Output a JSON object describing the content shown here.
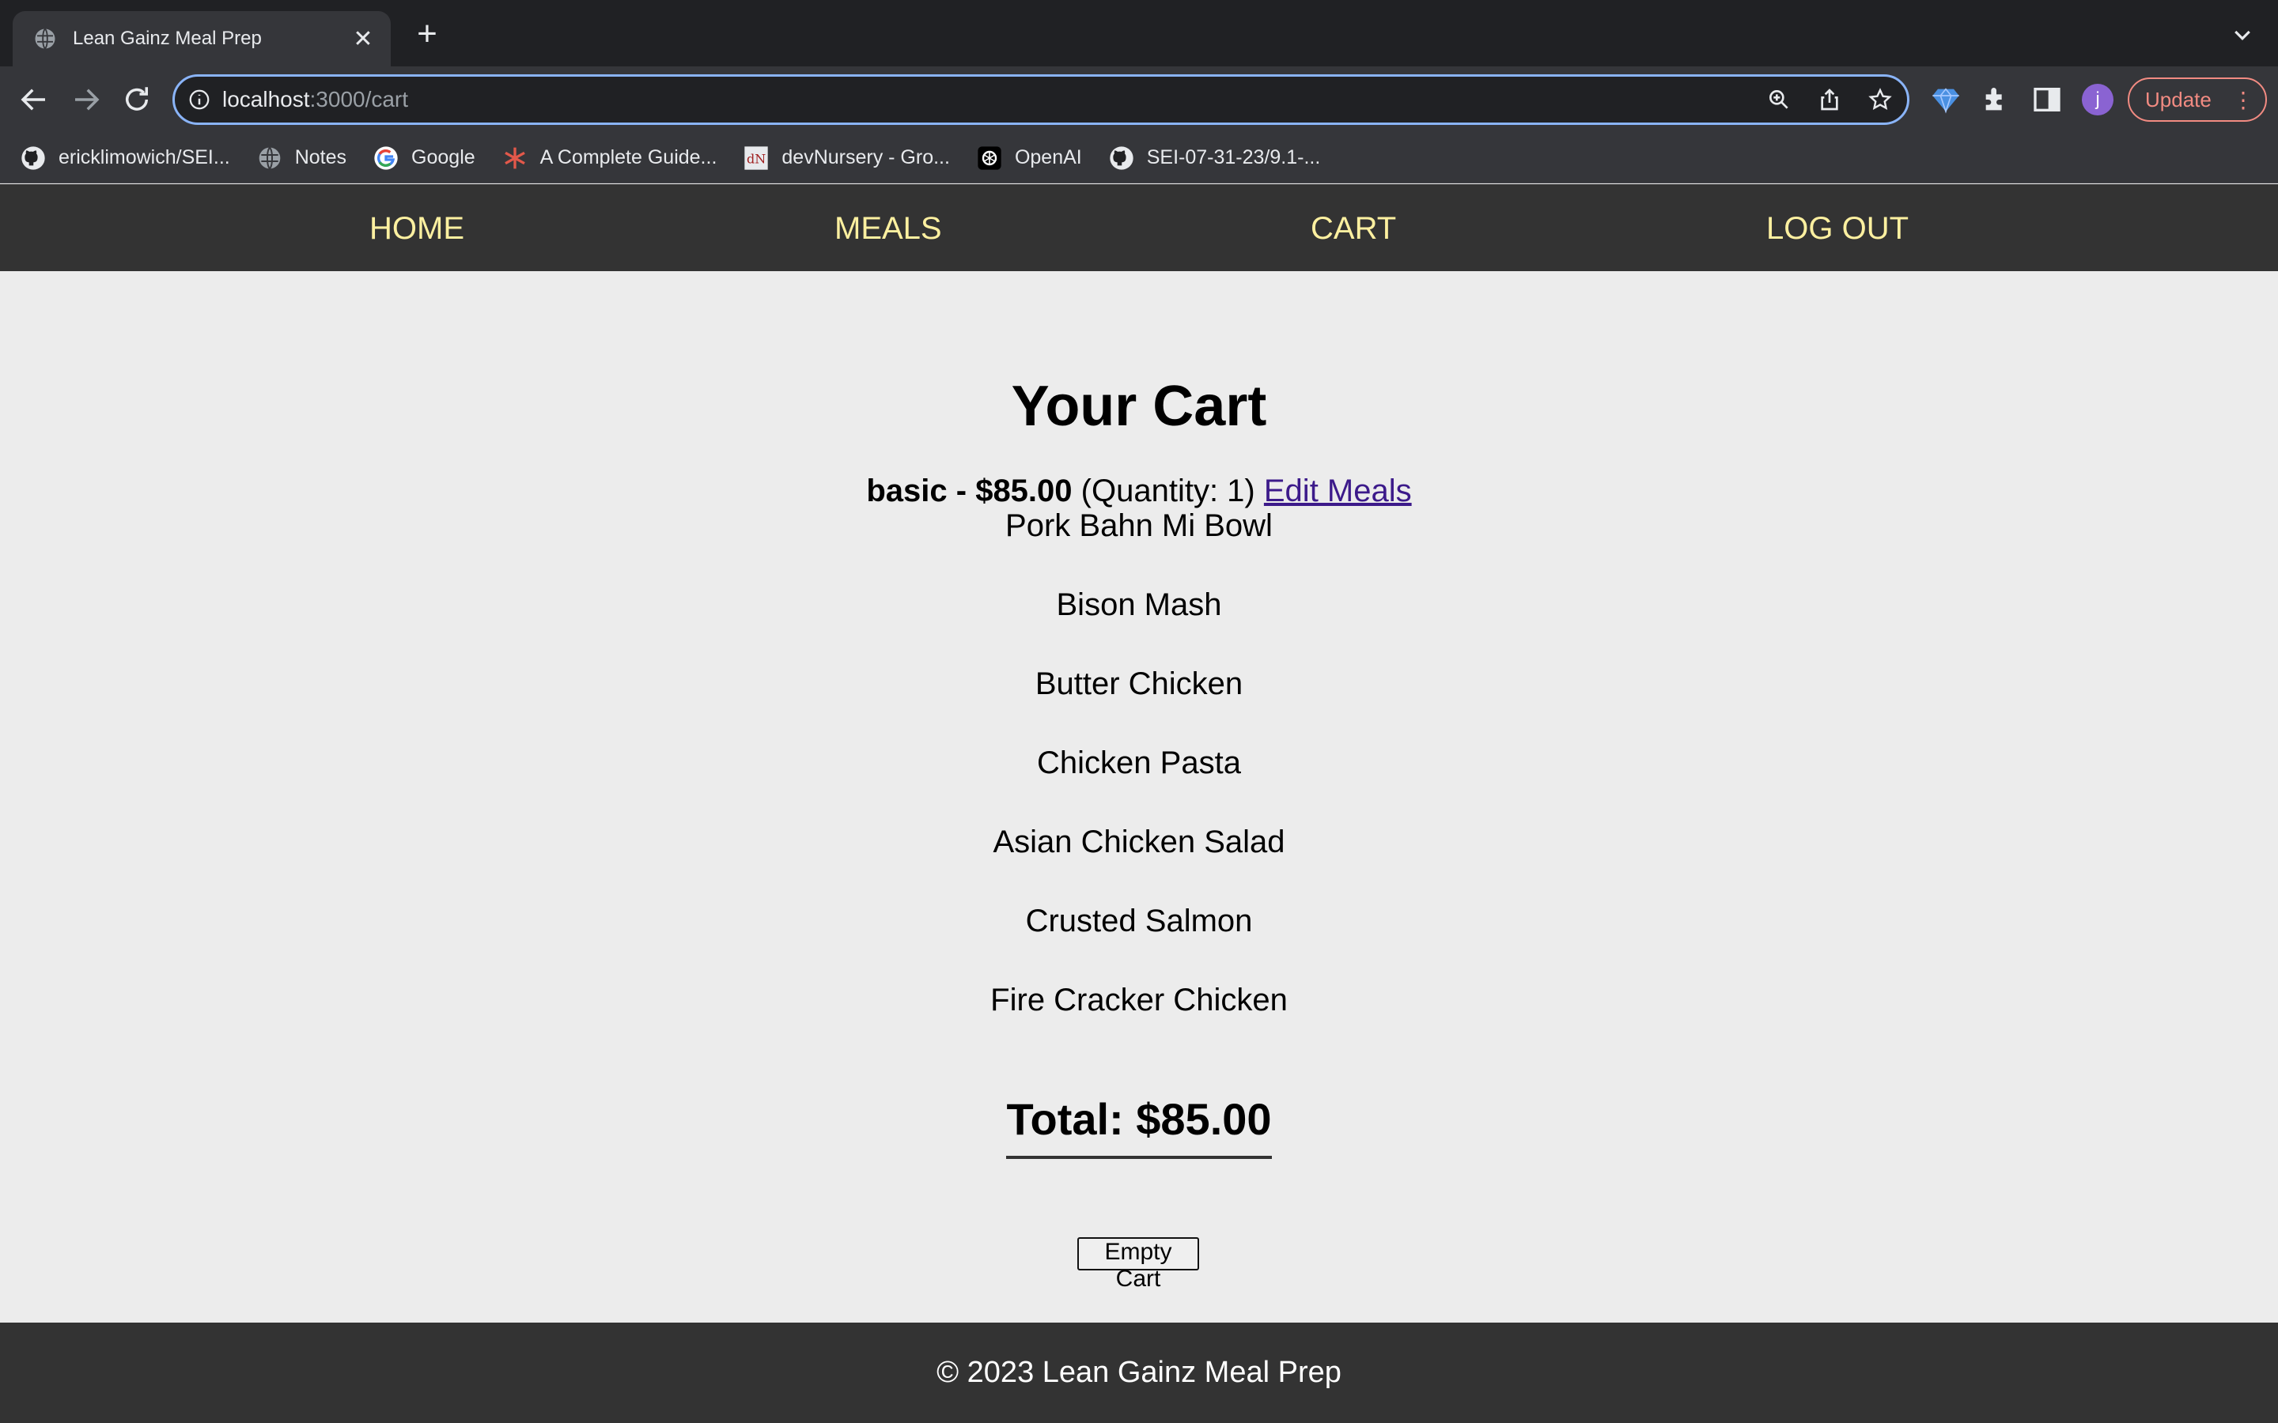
{
  "browser": {
    "tab_title": "Lean Gainz Meal Prep",
    "url_host": "localhost",
    "url_path": ":3000/cart",
    "update_label": "Update",
    "avatar_initial": "j",
    "bookmarks": [
      {
        "label": "ericklimowich/SEI...",
        "icon": "github-icon"
      },
      {
        "label": "Notes",
        "icon": "globe-icon"
      },
      {
        "label": "Google",
        "icon": "google-icon"
      },
      {
        "label": "A Complete Guide...",
        "icon": "asterisk-icon"
      },
      {
        "label": "devNursery - Gro...",
        "icon": "devnursery-icon"
      },
      {
        "label": "OpenAI",
        "icon": "openai-icon"
      },
      {
        "label": "SEI-07-31-23/9.1-...",
        "icon": "github-icon"
      }
    ]
  },
  "nav": {
    "home": "HOME",
    "meals": "MEALS",
    "cart": "CART",
    "logout": "LOG OUT"
  },
  "cart": {
    "title": "Your Cart",
    "plan_name_price": "basic - $85.00",
    "quantity_text": "(Quantity: 1)",
    "edit_link": "Edit Meals",
    "meals": [
      "Pork Bahn Mi Bowl",
      "Bison Mash",
      "Butter Chicken",
      "Chicken Pasta",
      "Asian Chicken Salad",
      "Crusted Salmon",
      "Fire Cracker Chicken"
    ],
    "total": "Total: $85.00",
    "empty_button": "Empty Cart"
  },
  "footer": {
    "text": "© 2023 Lean Gainz Meal Prep"
  },
  "colors": {
    "nav_bg": "#333333",
    "nav_link": "#fdf0a0",
    "page_bg": "#ececec",
    "link": "#3c1a8a"
  }
}
